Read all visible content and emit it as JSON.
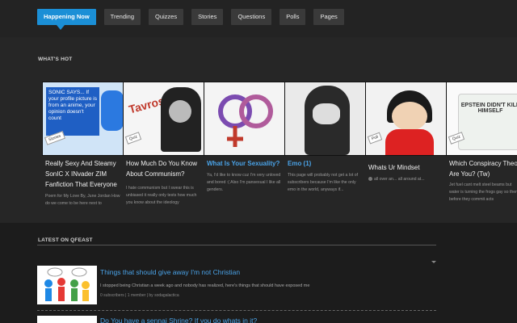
{
  "nav": {
    "items": [
      {
        "label": "Happening Now",
        "active": true
      },
      {
        "label": "Trending"
      },
      {
        "label": "Quizzes"
      },
      {
        "label": "Stories"
      },
      {
        "label": "Questions"
      },
      {
        "label": "Polls"
      },
      {
        "label": "Pages"
      }
    ]
  },
  "hot": {
    "title": "WHAT'S HOT",
    "cards": [
      {
        "title": "Really Sexy And Steamy SonIC X INvader ZIM Fanfiction That Everyone",
        "desc": "Poem for My Love By, June Jordan How do we come to be here next to",
        "tag": "Stories",
        "thumb_text": "SONIC SAYS... If your profile picture is from an anime, your opinion doesn't count",
        "color": "#2a6fd6"
      },
      {
        "title": "How Much Do You Know About Communism?",
        "desc": "I hate communism but I swear this is unbiased it really only tests how much you know about the ideology",
        "tag": "Quiz",
        "thumb_text": "Tavros",
        "color": "#c0392b"
      },
      {
        "title": "What Is Your Sexuality?",
        "desc": "Ya, I'd like to know cuz I'm very unloved and bored :( Also I'm pansexual I like all genders.",
        "tag": "",
        "thumb_text": "",
        "color": "#9b59b6",
        "blue": true
      },
      {
        "title": "Emo (1)",
        "desc": "This page will probably not get a lot of subscribers because I'm like the only emo in the world, anyways if...",
        "tag": "",
        "thumb_text": "",
        "color": "#dddddd",
        "blue": true
      },
      {
        "title": "Whats Ur Mindset",
        "desc": "all over an... all around at...",
        "tag": "Poll",
        "thumb_text": "",
        "color": "#e74c3c"
      },
      {
        "title": "Which Conspiracy Theory Are You? (Tw)",
        "desc": "Jet fuel cant melt steel beams but water is turning the frogs gay so them before they commit acts",
        "tag": "Quiz",
        "thumb_text": "EPSTEIN DIDN'T KILL HIMSELF",
        "color": "#eeeeee"
      }
    ]
  },
  "latest": {
    "title": "LATEST ON QFEAST",
    "items": [
      {
        "title": "Things that should give away I'm not Christian",
        "desc": "I stopped being Christian a week ago and nobody has realized, here's things that should have exposed me",
        "meta": "0 subscribers | 1 member | by sodagalactica"
      },
      {
        "title": "Do You have a sennai Shrine? If you do whats in it?",
        "desc": "",
        "meta": ""
      }
    ]
  }
}
